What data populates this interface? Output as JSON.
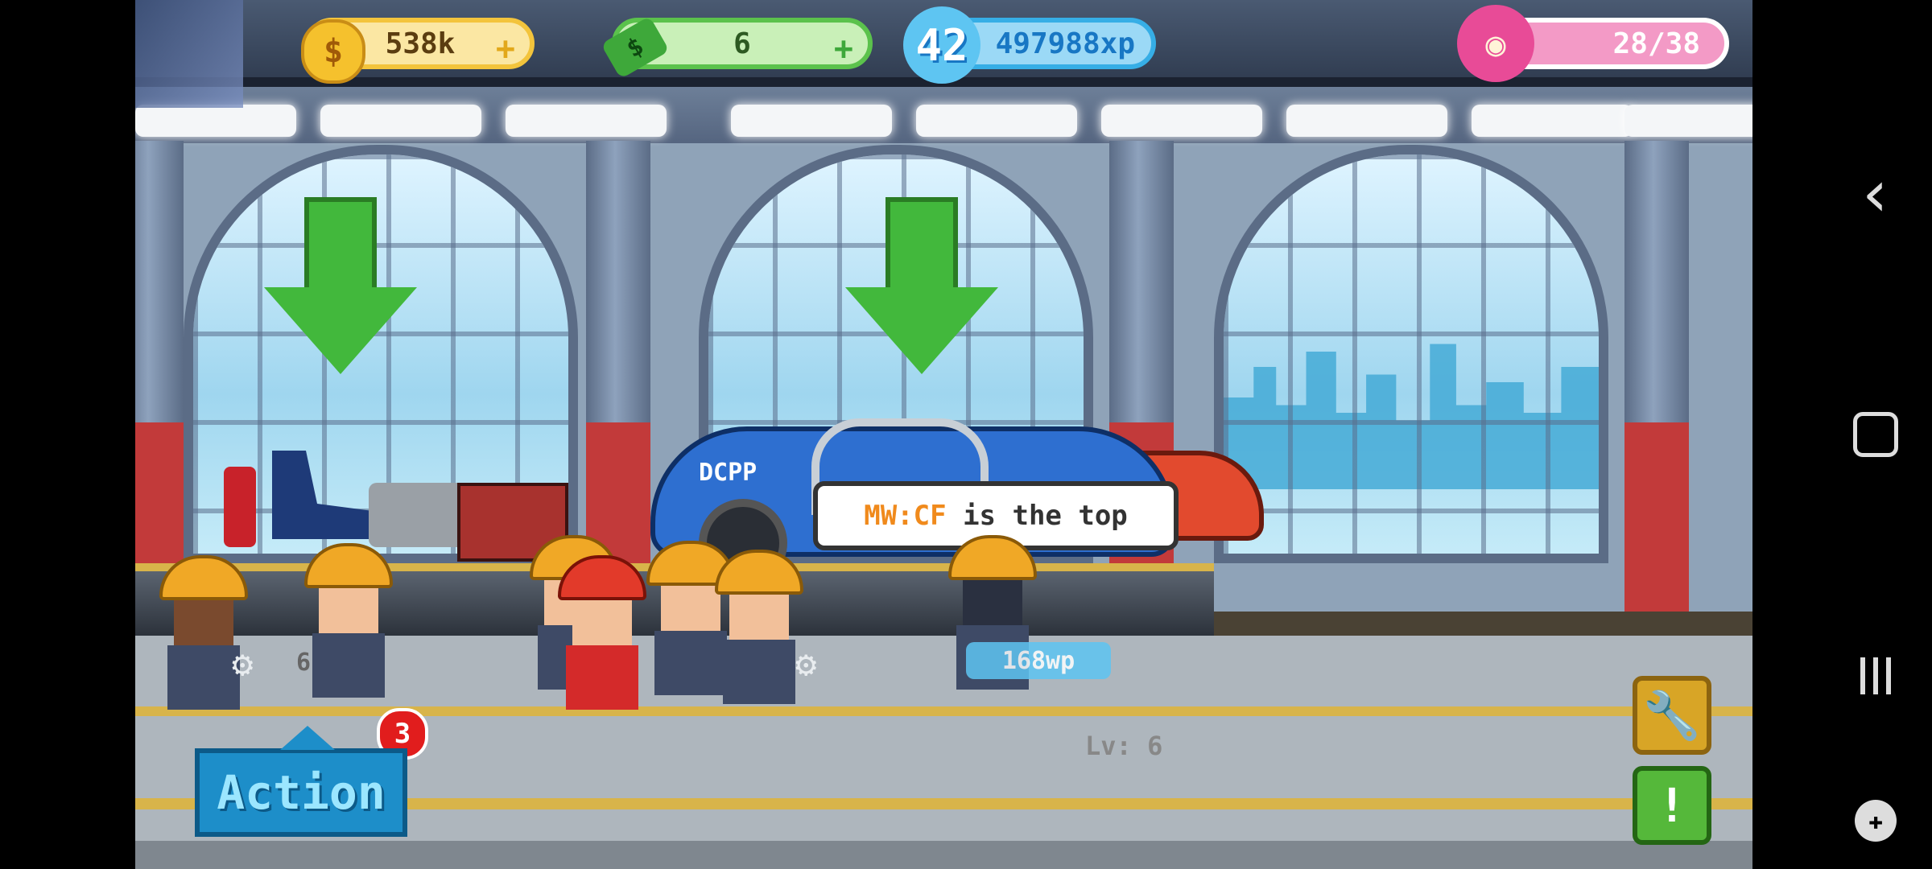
{
  "hud": {
    "coins": "538k",
    "coins_icon": "dollar-coin-icon",
    "cash": "6",
    "cash_icon": "banknote-icon",
    "level": "42",
    "xp": "497988xp",
    "donuts": "28/38",
    "donut_icon": "donut-icon",
    "plus": "+"
  },
  "speech_bubble": {
    "highlight": "MW:CF",
    "text": " is the top"
  },
  "workers": {
    "badge_count": "3",
    "xp_label": "168wp",
    "level_label": "Lv: 6",
    "partial_label": "6"
  },
  "buttons": {
    "action_label": "Action",
    "wrench_icon": "wrench-icon",
    "alert_label": "!"
  },
  "car": {
    "livery": "DCPP"
  },
  "nav": {
    "back": "‹",
    "home": "▢",
    "recents": "|||",
    "game": "game-controller-icon"
  },
  "colors": {
    "coin": "#f3c43c",
    "cash": "#5bc24c",
    "xp": "#36aee6",
    "donut": "#e84b97",
    "arrow": "#42b83c"
  }
}
